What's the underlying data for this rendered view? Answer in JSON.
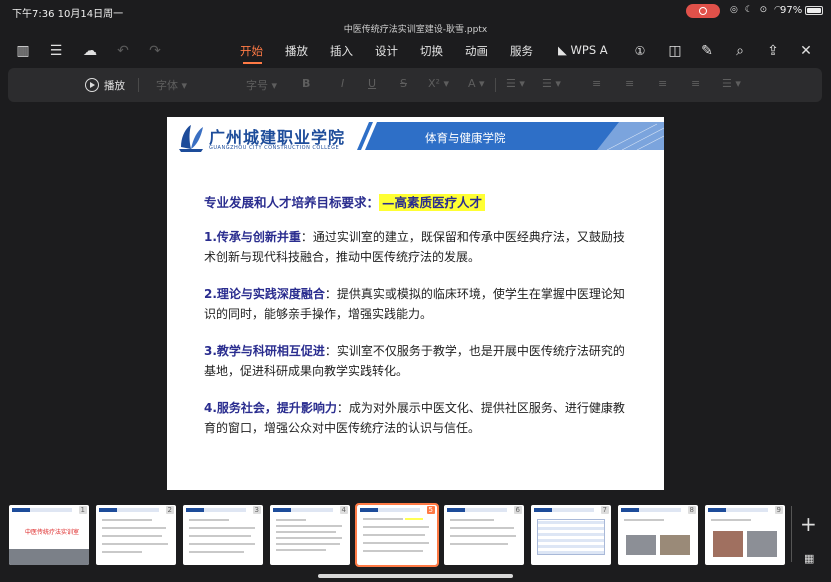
{
  "status": {
    "time": "下午7:36",
    "date": "10月14日周一",
    "battery": "97%",
    "battery_level": 0.97,
    "record_color": "#e0514a"
  },
  "document": {
    "title": "中医传统疗法实训室建设-耿雪.pptx"
  },
  "toolbar": {
    "tabs": [
      {
        "label": "开始",
        "active": true
      },
      {
        "label": "播放"
      },
      {
        "label": "插入"
      },
      {
        "label": "设计"
      },
      {
        "label": "切换"
      },
      {
        "label": "动画"
      },
      {
        "label": "服务"
      },
      {
        "label": "WPS A"
      }
    ],
    "accent": "#ff7a45"
  },
  "format_bar": {
    "play_label": "播放",
    "font_placeholder": "字体",
    "size_placeholder": "字号"
  },
  "slide": {
    "college_cn": "广州城建职业学院",
    "college_en": "GUANGZHOU CITY CONSTRUCTION COLLEGE",
    "department": "体育与健康学院",
    "heading": "专业发展和人才培养目标要求：",
    "heading_highlight": "—高素质医疗人才",
    "points": [
      {
        "lead": "1.传承与创新并重",
        "text": "：通过实训室的建立，既保留和传承中医经典疗法，又鼓励技术创新与现代科技融合，推动中医传统疗法的发展。"
      },
      {
        "lead": "2.理论与实践深度融合",
        "text": "：提供真实或模拟的临床环境，使学生在掌握中医理论知识的同时，能够亲手操作，增强实践能力。"
      },
      {
        "lead": "3.教学与科研相互促进",
        "text": "：实训室不仅服务于教学，也是开展中医传统疗法研究的基地，促进科研成果向教学实践转化。"
      },
      {
        "lead": "4.服务社会，提升影响力",
        "text": "：成为对外展示中医文化、提供社区服务、进行健康教育的窗口，增强公众对中医传统疗法的认识与信任。"
      }
    ],
    "brand_color": "#1d4c9a",
    "highlight_color": "#ffff33"
  },
  "thumbnails": {
    "numbers": [
      "1",
      "2",
      "3",
      "4",
      "5",
      "6",
      "7",
      "8",
      "9"
    ],
    "selected": "5",
    "first_title": "中医传统疗法实训室"
  }
}
